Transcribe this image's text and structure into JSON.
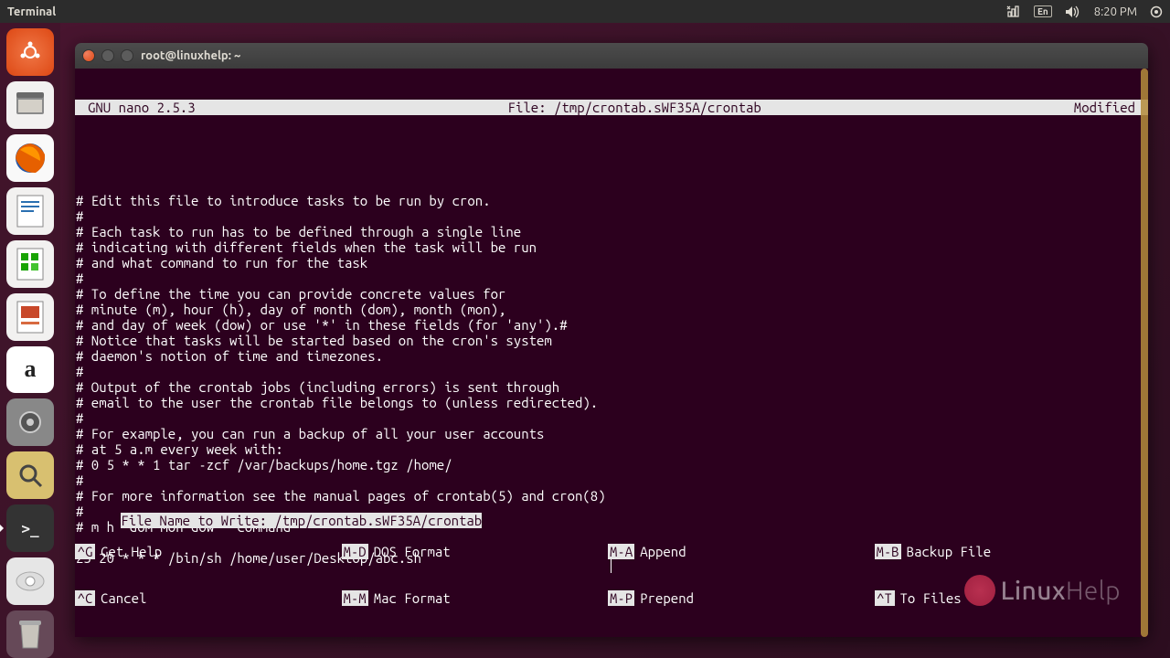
{
  "menubar": {
    "title": "Terminal",
    "lang": "En",
    "time": "8:20 PM"
  },
  "launcher": {
    "items": [
      {
        "name": "dash",
        "glyph": "◌"
      },
      {
        "name": "files",
        "glyph": "🗄"
      },
      {
        "name": "firefox",
        "glyph": "🦊"
      },
      {
        "name": "writer",
        "glyph": "📄"
      },
      {
        "name": "calc",
        "glyph": "📊"
      },
      {
        "name": "impress",
        "glyph": "📋"
      },
      {
        "name": "amazon",
        "glyph": "a"
      },
      {
        "name": "settings",
        "glyph": "⚙"
      },
      {
        "name": "search",
        "glyph": "🔍"
      },
      {
        "name": "terminal",
        "glyph": ">_"
      },
      {
        "name": "drive",
        "glyph": "💿"
      },
      {
        "name": "trash",
        "glyph": "🗑"
      }
    ]
  },
  "window": {
    "title": "root@linuxhelp: ~"
  },
  "nano": {
    "version": "GNU nano 2.5.3",
    "file_label": "File: /tmp/crontab.sWF35A/crontab",
    "status": "Modified",
    "content": [
      "# Edit this file to introduce tasks to be run by cron.",
      "#",
      "# Each task to run has to be defined through a single line",
      "# indicating with different fields when the task will be run",
      "# and what command to run for the task",
      "#",
      "# To define the time you can provide concrete values for",
      "# minute (m), hour (h), day of month (dom), month (mon),",
      "# and day of week (dow) or use '*' in these fields (for 'any').#",
      "# Notice that tasks will be started based on the cron's system",
      "# daemon's notion of time and timezones.",
      "#",
      "# Output of the crontab jobs (including errors) is sent through",
      "# email to the user the crontab file belongs to (unless redirected).",
      "#",
      "# For example, you can run a backup of all your user accounts",
      "# at 5 a.m every week with:",
      "# 0 5 * * 1 tar -zcf /var/backups/home.tgz /home/",
      "#",
      "# For more information see the manual pages of crontab(5) and cron(8)",
      "#",
      "# m h  dom mon dow   command",
      "",
      "23 20 * * * /bin/sh /home/user/Desktop/abc.sh"
    ],
    "prompt": "File Name to Write: /tmp/crontab.sWF35A/crontab",
    "shortcuts_row1": [
      {
        "key": "^G",
        "label": "Get Help"
      },
      {
        "key": "M-D",
        "label": "DOS Format"
      },
      {
        "key": "M-A",
        "label": "Append"
      },
      {
        "key": "M-B",
        "label": "Backup File"
      }
    ],
    "shortcuts_row2": [
      {
        "key": "^C",
        "label": "Cancel"
      },
      {
        "key": "M-M",
        "label": "Mac Format"
      },
      {
        "key": "M-P",
        "label": "Prepend"
      },
      {
        "key": "^T",
        "label": "To Files"
      }
    ]
  },
  "watermark": {
    "text_a": "Linux",
    "text_b": "Help"
  }
}
